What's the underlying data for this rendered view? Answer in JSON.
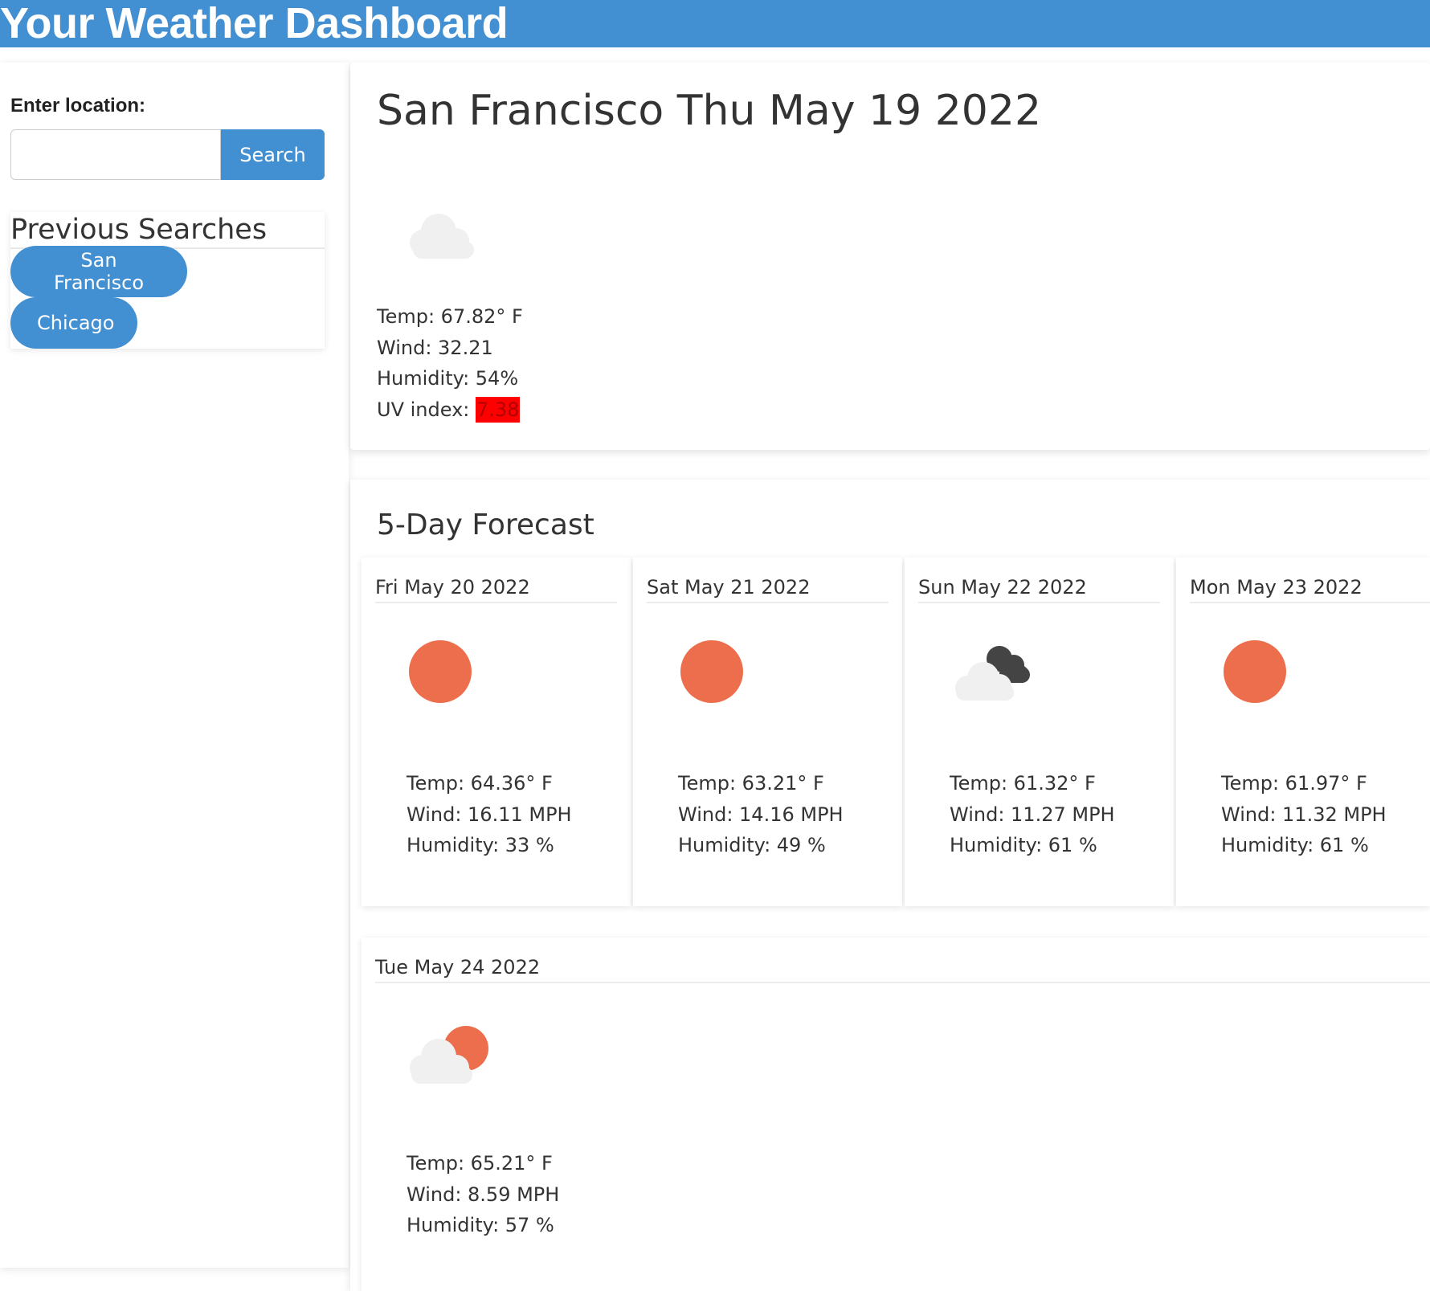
{
  "header": {
    "title": "Your Weather Dashboard"
  },
  "colors": {
    "accent": "#428fd1",
    "sun": "#ec6e4c",
    "cloud": "#f0f0f0",
    "dark_cloud": "#444444",
    "uv_high": "#ff0000"
  },
  "sidebar": {
    "location_label": "Enter location:",
    "search_value": "",
    "search_button": "Search",
    "previous_title": "Previous Searches",
    "previous": [
      "San Francisco",
      "Chicago"
    ]
  },
  "current": {
    "title": "San Francisco Thu May 19 2022",
    "icon": "cloud-icon",
    "temp": "Temp: 67.82° F",
    "wind": "Wind: 32.21",
    "humidity": "Humidity: 54%",
    "uv_label": "UV index:",
    "uv_value": "7.38"
  },
  "forecast": {
    "title": "5-Day Forecast",
    "days": [
      {
        "date": "Fri May 20 2022",
        "icon": "sun-icon",
        "temp": "Temp: 64.36° F",
        "wind": "Wind: 16.11 MPH",
        "humidity": "Humidity: 33 %"
      },
      {
        "date": "Sat May 21 2022",
        "icon": "sun-icon",
        "temp": "Temp: 63.21° F",
        "wind": "Wind: 14.16 MPH",
        "humidity": "Humidity: 49 %"
      },
      {
        "date": "Sun May 22 2022",
        "icon": "broken-clouds-icon",
        "temp": "Temp: 61.32° F",
        "wind": "Wind: 11.27 MPH",
        "humidity": "Humidity: 61 %"
      },
      {
        "date": "Mon May 23 2022",
        "icon": "sun-icon",
        "temp": "Temp: 61.97° F",
        "wind": "Wind: 11.32 MPH",
        "humidity": "Humidity: 61 %"
      },
      {
        "date": "Tue May 24 2022",
        "icon": "partly-cloudy-icon",
        "temp": "Temp: 65.21° F",
        "wind": "Wind: 8.59 MPH",
        "humidity": "Humidity: 57 %"
      }
    ]
  }
}
